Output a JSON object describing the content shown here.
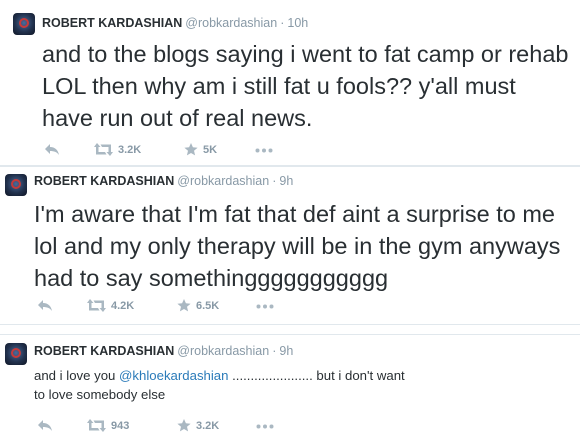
{
  "tweets": [
    {
      "name": "ROBERT KARDASHIAN",
      "handle": "@robkardashian",
      "separator": "·",
      "time": "10h",
      "text": "and to the blogs saying i went to fat camp or rehab LOL then why am i still fat u fools?? y'all must have run out of real news.",
      "retweets": "3.2K",
      "favorites": "5K"
    },
    {
      "name": "ROBERT KARDASHIAN",
      "handle": "@robkardashian",
      "separator": "·",
      "time": "9h",
      "text": "I'm aware that I'm fat that def aint a surprise to me lol and my only therapy will be in the gym anyways had to say somethinggggggggggg",
      "retweets": "4.2K",
      "favorites": "6.5K"
    },
    {
      "name": "ROBERT KARDASHIAN",
      "handle": "@robkardashian",
      "separator": "·",
      "time": "9h",
      "text_before": "and i love you ",
      "mention": "@khloekardashian",
      "text_after": " ...................... but i don't want to love somebody else",
      "retweets": "943",
      "favorites": "3.2K"
    }
  ],
  "icons": {
    "reply": "reply-icon",
    "retweet": "retweet-icon",
    "favorite": "star-icon",
    "more": "more-icon"
  },
  "colors": {
    "text": "#292f33",
    "muted": "#8899a6",
    "link": "#2b7bb9",
    "divider": "#e1e8ed"
  }
}
